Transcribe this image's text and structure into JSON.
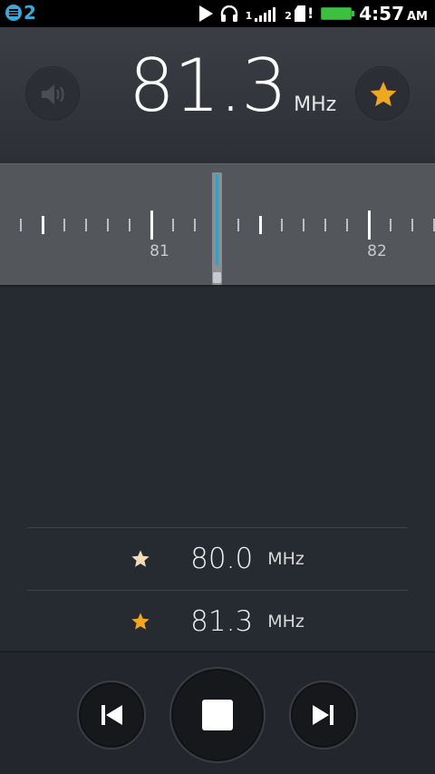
{
  "status_bar": {
    "notification_count": "2",
    "sim1_label": "1",
    "sim2_label": "2",
    "sim2_alert": "!",
    "time": "4:57",
    "ampm": "AM",
    "battery_color": "#3dc040"
  },
  "header": {
    "frequency": "81.3",
    "unit": "MHz",
    "speaker_icon": "speaker-icon",
    "favorite_icon": "star-icon",
    "favorite_active": true,
    "accent_color": "#f0a81e"
  },
  "dial": {
    "labels": [
      "81",
      "82"
    ],
    "needle_color": "#3a9fbf"
  },
  "favorites": [
    {
      "frequency": "80.0",
      "unit": "MHz",
      "star": "star-outline-icon"
    },
    {
      "frequency": "81.3",
      "unit": "MHz",
      "star": "star-filled-icon"
    }
  ],
  "controls": {
    "previous": "skip-previous-icon",
    "stop": "stop-icon",
    "next": "skip-next-icon"
  }
}
